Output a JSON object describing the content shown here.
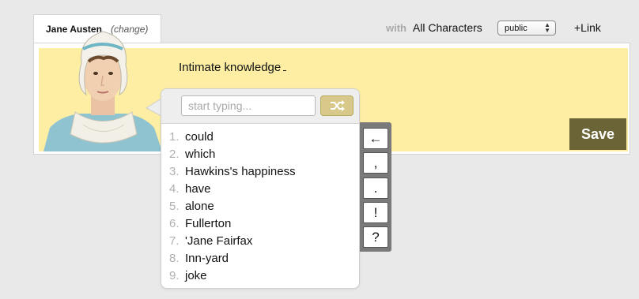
{
  "author_tab": {
    "name": "Jane Austen",
    "change_label": "(change)"
  },
  "header": {
    "with_label": "with",
    "characters": "All Characters",
    "visibility": "public",
    "link_label": "+Link"
  },
  "composer": {
    "text": "Intimate knowledge",
    "save_label": "Save"
  },
  "suggest": {
    "placeholder": "start typing...",
    "shuffle_icon": "shuffle-icon",
    "items": [
      {
        "num": "1.",
        "word": "could"
      },
      {
        "num": "2.",
        "word": "which"
      },
      {
        "num": "3.",
        "word": "Hawkins's happiness"
      },
      {
        "num": "4.",
        "word": "have"
      },
      {
        "num": "5.",
        "word": "alone"
      },
      {
        "num": "6.",
        "word": "Fullerton"
      },
      {
        "num": "7.",
        "word": "'Jane Fairfax"
      },
      {
        "num": "8.",
        "word": "Inn-yard"
      },
      {
        "num": "9.",
        "word": "joke"
      }
    ]
  },
  "punctuation": [
    "←",
    ",",
    ".",
    "!",
    "?"
  ],
  "colors": {
    "panel_yellow": "#fdeea4",
    "save_bg": "#6b6436",
    "shuffle_bg": "#d8c98a",
    "punct_bar": "#7a7a7a"
  }
}
